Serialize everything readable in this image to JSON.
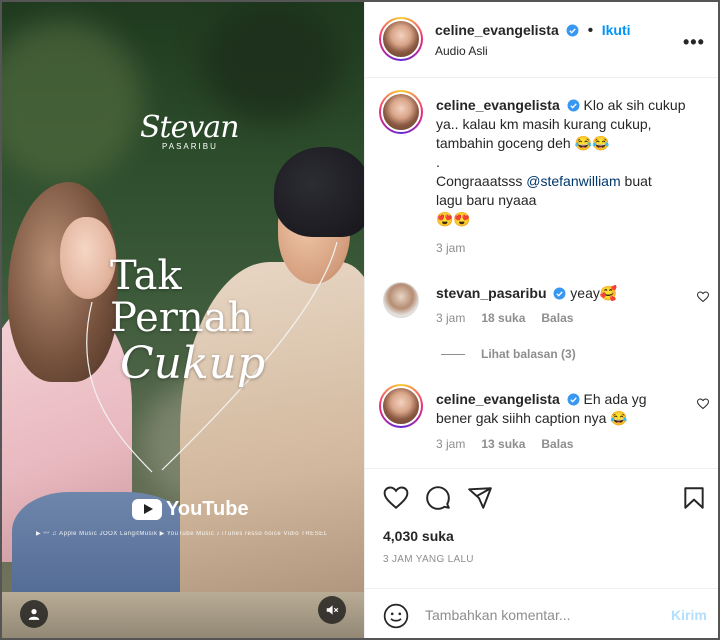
{
  "media": {
    "brand_name": "Stevan",
    "brand_sub": "PASARIBU",
    "title_lines": [
      "Tak",
      "Pernah",
      "Cukup"
    ],
    "youtube_label": "YouTube",
    "platforms": "▶ 〰 ♫ Apple Music  JOOX  LangitMusik  ▶ YouTube Music  ♪  iTunes  resso  noice  Vidio  TRESEL"
  },
  "post": {
    "author": "celine_evangelista",
    "follow_label": "Ikuti",
    "audio_label": "Audio Asli",
    "more_label": "•••"
  },
  "comments": [
    {
      "user": "celine_evangelista",
      "text_lines": [
        "Klo ak sih cukup",
        "ya.. kalau km masih kurang cukup,",
        "tambahin goceng deh 😂😂",
        ".",
        "Congraaatsss @stefanwilliam buat",
        "lagu baru nyaaa",
        "😍😍"
      ],
      "time": "3 jam"
    },
    {
      "user": "stevan_pasaribu",
      "text": "yeay🥰",
      "time": "3 jam",
      "likes": "18 suka",
      "reply": "Balas"
    },
    {
      "user": "celine_evangelista",
      "text_lines": [
        "Eh ada yg",
        "bener gak siihh caption nya 😂"
      ],
      "time": "3 jam",
      "likes": "13 suka",
      "reply": "Balas"
    }
  ],
  "view_replies": "Lihat balasan (3)",
  "likes_count": "4,030 suka",
  "posted_ago": "3 JAM YANG LALU",
  "compose": {
    "placeholder": "Tambahkan komentar...",
    "send_label": "Kirim"
  },
  "colors": {
    "accent": "#0095f6",
    "verified": "#3897f0",
    "send_disabled": "#b2dffc",
    "muted_text": "#8e8e8e"
  },
  "icons": [
    "verified-badge-icon",
    "more-options-icon",
    "heart-icon",
    "comment-icon",
    "share-icon",
    "bookmark-icon",
    "emoji-icon",
    "tag-user-icon",
    "mute-icon",
    "youtube-logo-icon"
  ]
}
